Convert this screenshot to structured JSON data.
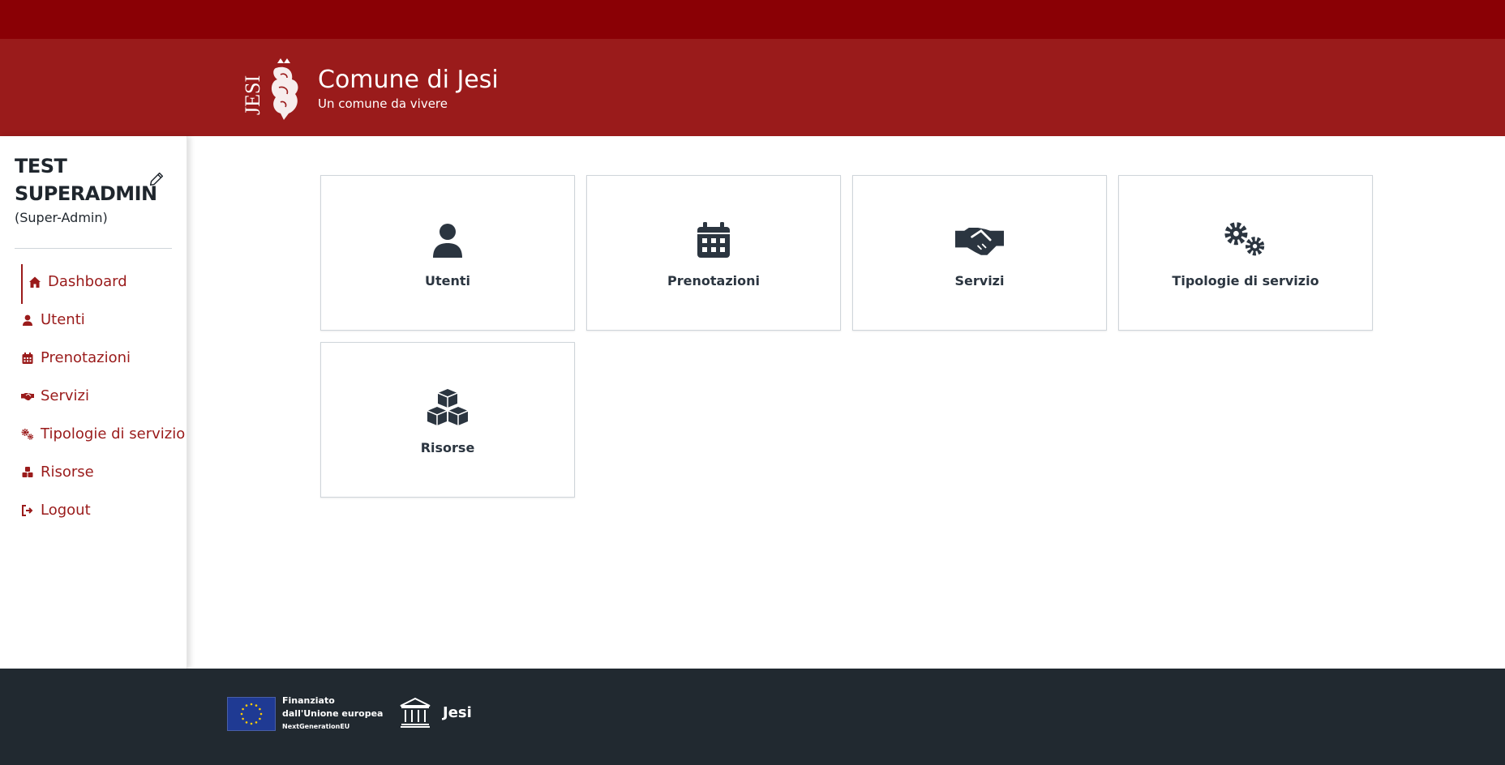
{
  "header": {
    "title": "Comune di Jesi",
    "subtitle": "Un comune da vivere",
    "logo_text": "JESI"
  },
  "user": {
    "name_line1": "TEST",
    "name_line2": "SUPERADMIN",
    "role": "(Super-Admin)"
  },
  "sidebar": {
    "items": [
      {
        "label": "Dashboard",
        "icon": "home-icon"
      },
      {
        "label": "Utenti",
        "icon": "user-icon"
      },
      {
        "label": "Prenotazioni",
        "icon": "calendar-icon"
      },
      {
        "label": "Servizi",
        "icon": "handshake-icon"
      },
      {
        "label": "Tipologie di servizio",
        "icon": "gears-icon"
      },
      {
        "label": "Risorse",
        "icon": "cubes-icon"
      },
      {
        "label": "Logout",
        "icon": "logout-icon"
      }
    ],
    "active": "Dashboard"
  },
  "tiles": [
    {
      "label": "Utenti",
      "icon": "user-icon"
    },
    {
      "label": "Prenotazioni",
      "icon": "calendar-icon"
    },
    {
      "label": "Servizi",
      "icon": "handshake-icon"
    },
    {
      "label": "Tipologie di servizio",
      "icon": "gears-icon"
    },
    {
      "label": "Risorse",
      "icon": "cubes-icon"
    }
  ],
  "footer": {
    "eu_line1": "Finanziato",
    "eu_line2": "dall'Unione europea",
    "eu_line3": "NextGenerationEU",
    "city": "Jesi"
  },
  "colors": {
    "topbar": "#8a0005",
    "header": "#9a1b1b",
    "accent": "#9a1b1b",
    "footer": "#212930"
  }
}
